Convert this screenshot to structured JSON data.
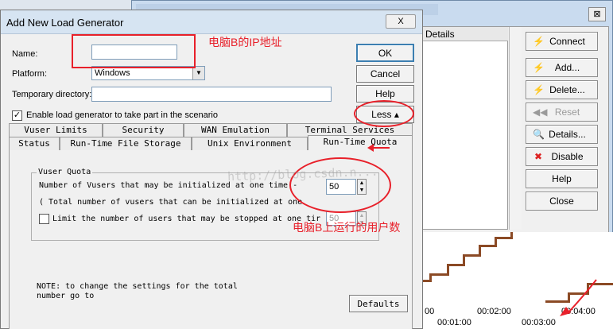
{
  "background_window": {
    "close_glyph": "⊠",
    "column_header": "Details",
    "buttons": [
      {
        "label": "Connect",
        "icon": "connect-icon",
        "glyph": "⚡",
        "disabled": false
      },
      {
        "label": "Add...",
        "icon": "add-icon",
        "glyph": "⚡",
        "disabled": false
      },
      {
        "label": "Delete...",
        "icon": "delete-icon",
        "glyph": "⚡",
        "disabled": false
      },
      {
        "label": "Reset",
        "icon": "reset-icon",
        "glyph": "◀◀",
        "disabled": true
      },
      {
        "label": "Details...",
        "icon": "details-icon",
        "glyph": "🔍",
        "disabled": false
      },
      {
        "label": "Disable",
        "icon": "disable-icon",
        "glyph": "✖",
        "disabled": false
      },
      {
        "label": "Help",
        "icon": "",
        "glyph": "",
        "disabled": false
      },
      {
        "label": "Close",
        "icon": "",
        "glyph": "",
        "disabled": false
      }
    ],
    "graph": {
      "x_ticks_top": [
        "00",
        "00:02:00",
        "00:04:00"
      ],
      "x_ticks_bottom": [
        "00:01:00",
        "00:03:00"
      ]
    }
  },
  "dialog": {
    "title": "Add New Load Generator",
    "close_glyph": "X",
    "fields": {
      "name_label": "Name:",
      "name_value": "",
      "platform_label": "Platform:",
      "platform_value": "Windows",
      "temp_dir_label": "Temporary directory:",
      "temp_dir_value": ""
    },
    "enable_checkbox": {
      "label": "Enable load generator to take part in the scenario",
      "checked": true,
      "mark": "✓"
    },
    "buttons": {
      "ok": "OK",
      "cancel": "Cancel",
      "help": "Help",
      "less": "Less ▴",
      "defaults": "Defaults"
    },
    "tabs_row1": [
      "Vuser Limits",
      "Security",
      "WAN Emulation",
      "Terminal Services"
    ],
    "tabs_row2": [
      "Status",
      "Run-Time File Storage",
      "Unix Environment",
      "Run-Time Quota"
    ],
    "active_tab": "Run-Time Quota",
    "quota": {
      "group_title": "Vuser Quota",
      "num_vusers_label": "Number of Vusers that may be initialized at one time -",
      "num_vusers_value": "50",
      "total_label": "( Total number of vusers that can be initialized at one",
      "limit_label": "Limit the number of users that may be stopped at one tir",
      "limit_value": "50",
      "note_line1": "NOTE: to change the settings for the total",
      "note_line2": "number go to"
    }
  },
  "annotations": {
    "ip_note": "电脑B的IP地址",
    "users_note": "电脑B上运行的用户数",
    "watermark": "http://blog.csdn.n..."
  },
  "accent_colors": {
    "annotation_red": "#e8202a",
    "graph_line": "#8b4a25"
  }
}
